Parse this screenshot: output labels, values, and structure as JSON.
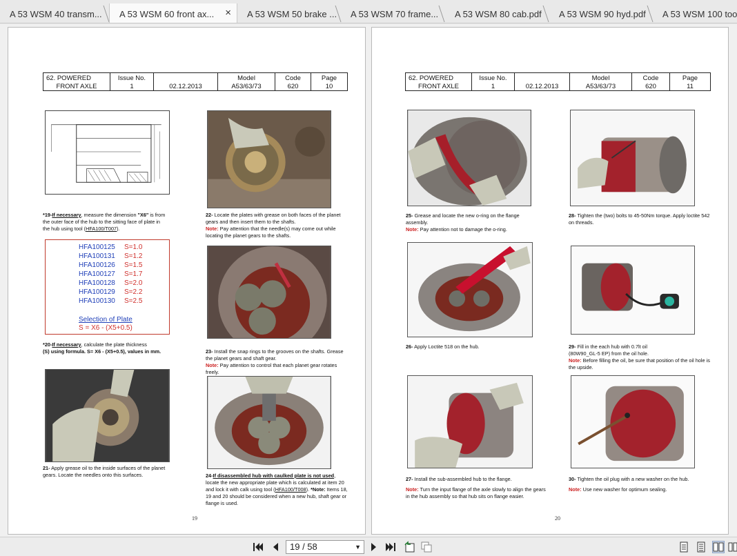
{
  "tabs": [
    {
      "label": "A 53  WSM 40 transm...",
      "active": false
    },
    {
      "label": "A 53  WSM 60 front ax...",
      "active": true
    },
    {
      "label": "A 53  WSM 50 brake ...",
      "active": false
    },
    {
      "label": "A 53  WSM 70 frame...",
      "active": false
    },
    {
      "label": "A 53  WSM 80 cab.pdf",
      "active": false
    },
    {
      "label": "A 53  WSM 90 hyd.pdf",
      "active": false
    },
    {
      "label": "A 53  WSM 100 too",
      "active": false
    }
  ],
  "tab_close": "×",
  "left_page": {
    "header": {
      "section_line1": "62. POWERED",
      "section_line2": "FRONT AXLE",
      "issue_label": "Issue No.",
      "issue_value": "1",
      "date": "02.12.2013",
      "model_label": "Model",
      "model_value": "A53/63/73",
      "code_label": "Code",
      "code_value": "620",
      "page_label": "Page",
      "page_value": "10"
    },
    "cap19": {
      "prefix": "*19-",
      "bold": "If necessary",
      "text1": ", measure the dimension ",
      "x6": "\"X6\"",
      "text2": " is from the outer face of the hub to the sitting face of plate in the hub using tool  (",
      "tool": "HFA100/T007",
      "text3": ")."
    },
    "cap22": {
      "prefix": "22-",
      "text": " Locate the plates with grease on both faces of the planet gears and then insert them to the shafts.",
      "note_label": "Note:",
      "note": " Pay attention that the needle(s) may come out while locating the planet gears to the shafts."
    },
    "plates": {
      "rows": [
        {
          "code": "HFA100125",
          "s": "S=1.0"
        },
        {
          "code": "HFA100131",
          "s": "S=1.2"
        },
        {
          "code": "HFA100126",
          "s": "S=1.5"
        },
        {
          "code": "HFA100127",
          "s": "S=1.7"
        },
        {
          "code": "HFA100128",
          "s": "S=2.0"
        },
        {
          "code": "HFA100129",
          "s": "S=2.2"
        },
        {
          "code": "HFA100130",
          "s": "S=2.5"
        }
      ],
      "selection_title": "Selection of Plate",
      "selection_formula": "S = X6 - (X5+0.5)"
    },
    "cap20": {
      "prefix": "*20-",
      "bold": "If necessary",
      "text1": ", calculate the plate thickness",
      "line2": "(S) using formula. S= X6 - (X5+0.5), values in mm."
    },
    "cap23": {
      "prefix": "23-",
      "text": " Install the snap rings to the grooves on the shafts. Grease the planet gears and shaft gear.",
      "note_label": "Note:",
      "note": " Pay attention to control that each planet gear rotates freely."
    },
    "cap21": {
      "prefix": "21-",
      "text": " Apply grease oil to the inside surfaces of the planet gears. Locate the needles onto this surfaces."
    },
    "cap24": {
      "prefix": "24-",
      "u": "If disassembled hub with caulked plate is not used",
      "text1": ", locate the new appropriate plate which is calculated at item 20 and lock it with calk using tool  (",
      "tool": "HFA100/T008",
      "text2": "). ",
      "note_label": "*Note:",
      "note": " Items 18, 19 and 20 should be considered when a new hub, shaft gear or flange is used."
    },
    "page_number": "19"
  },
  "right_page": {
    "header": {
      "section_line1": "62. POWERED",
      "section_line2": "FRONT AXLE",
      "issue_label": "Issue No.",
      "issue_value": "1",
      "date": "02.12.2013",
      "model_label": "Model",
      "model_value": "A53/63/73",
      "code_label": "Code",
      "code_value": "620",
      "page_label": "Page",
      "page_value": "11"
    },
    "cap25": {
      "prefix": "25-",
      "text": " Grease and locate the new o-ring on the flange assembly.",
      "note_label": "Note:",
      "note": " Pay attention not to damage the o-ring."
    },
    "cap28": {
      "prefix": "28-",
      "text": " Tighten the (two) bolts to 45-50Nm torque. Apply loctite 542 on threads."
    },
    "cap26": {
      "prefix": "26-",
      "text": " Apply Loctite 518 on the hub."
    },
    "cap29": {
      "prefix": "29-",
      "text1": " Fill in the each hub with 0.7lt oil",
      "text2": "(80W90_GL-5 EP) from the oil hole.",
      "note_label": "Note:",
      "note": " Before filling the oil, be sure that position of the oil hole is the upside."
    },
    "cap27": {
      "prefix": "27-",
      "text": " Install the sub-assembled hub to the flange.",
      "note_label": "Note:",
      "note": " Turn the input flange of the axle slowly to align the gears in the hub assembly so that hub sits on flange easier."
    },
    "cap30": {
      "prefix": "30-",
      "text": " Tighten the oil plug with a new washer on the hub.",
      "note_label": "Note:",
      "note": " Use new washer for optimum sealing."
    },
    "page_number": "20"
  },
  "toolbar": {
    "page_display": "19 / 58",
    "icons": [
      "first-page-icon",
      "prev-page-icon",
      "next-page-icon",
      "last-page-icon",
      "rotate-icon",
      "view-icon",
      "single-page-icon",
      "continuous-icon",
      "two-page-icon",
      "two-page-continuous-icon"
    ]
  },
  "colors": {
    "note_red": "#cc2020",
    "plate_blue": "#1f3fb8",
    "hub_red": "#a31f2a"
  }
}
